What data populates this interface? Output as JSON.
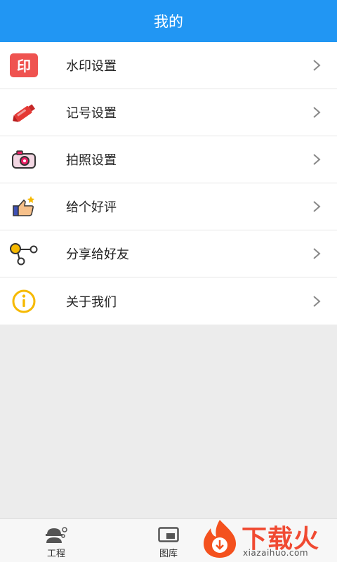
{
  "header": {
    "title": "我的"
  },
  "menu": [
    {
      "label": "水印设置",
      "icon": "watermark-stamp-icon",
      "icon_text": "印"
    },
    {
      "label": "记号设置",
      "icon": "marker-pen-icon"
    },
    {
      "label": "拍照设置",
      "icon": "camera-icon"
    },
    {
      "label": "给个好评",
      "icon": "thumbs-up-icon"
    },
    {
      "label": "分享给好友",
      "icon": "share-nodes-icon"
    },
    {
      "label": "关于我们",
      "icon": "info-icon"
    }
  ],
  "tabbar": {
    "tabs": [
      {
        "label": "工程",
        "icon": "engineer-icon"
      },
      {
        "label": "图库",
        "icon": "gallery-icon"
      }
    ]
  },
  "watermark": {
    "text": "下载火",
    "sub": "xiazaihuo.com"
  },
  "colors": {
    "accent": "#2196f3",
    "stamp_red": "#ef5350",
    "info_yellow": "#f6b900"
  }
}
